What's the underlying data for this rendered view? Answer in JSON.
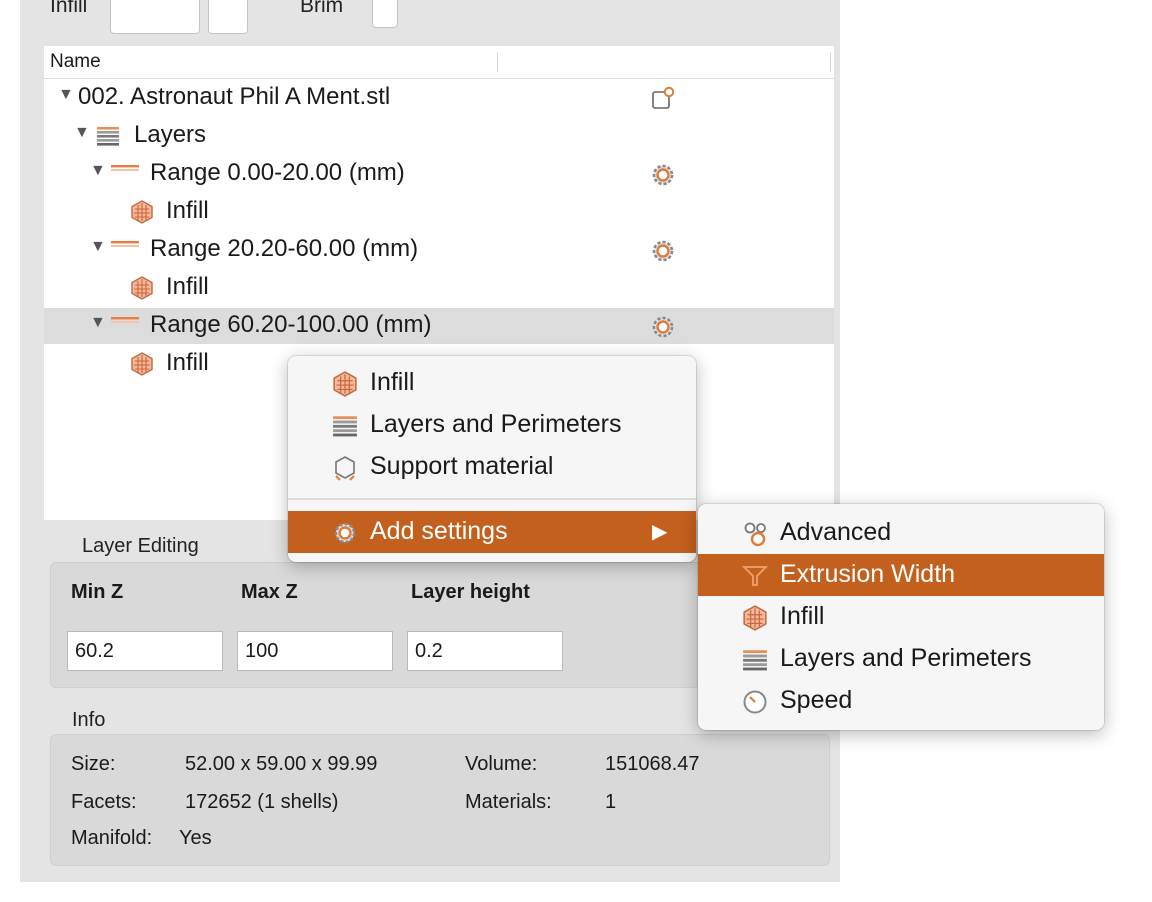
{
  "top_row": {
    "label_left": "Infill",
    "label_right": "Brim"
  },
  "tree": {
    "column_name": "Name",
    "rows": [
      {
        "label": "002. Astronaut Phil A Ment.stl",
        "icon": "object-settings-icon"
      },
      {
        "label": "Layers",
        "icon": "layers-icon"
      },
      {
        "label": "Range 0.00-20.00 (mm)",
        "icon": "range-icon"
      },
      {
        "label": "Infill",
        "icon": "infill-icon"
      },
      {
        "label": "Range 20.20-60.00 (mm)",
        "icon": "range-icon"
      },
      {
        "label": "Infill",
        "icon": "infill-icon"
      },
      {
        "label": "Range 60.20-100.00 (mm)",
        "icon": "range-icon",
        "selected": true
      },
      {
        "label": "Infill",
        "icon": "infill-icon"
      }
    ]
  },
  "layer_editing": {
    "title": "Layer Editing",
    "min_z_label": "Min Z",
    "max_z_label": "Max Z",
    "layer_height_label": "Layer height",
    "min_z": "60.2",
    "max_z": "100",
    "layer_height": "0.2"
  },
  "info": {
    "title": "Info",
    "size_label": "Size:",
    "size": "52.00 x 59.00 x 99.99",
    "volume_label": "Volume:",
    "volume": "151068.47",
    "facets_label": "Facets:",
    "facets": "172652 (1 shells)",
    "materials_label": "Materials:",
    "materials": "1",
    "manifold_label": "Manifold:",
    "manifold": "Yes"
  },
  "context_menu": {
    "items": [
      "Infill",
      "Layers and Perimeters",
      "Support material"
    ],
    "add_settings": "Add settings",
    "arrow": "▶"
  },
  "submenu": {
    "items": [
      "Advanced",
      "Extrusion Width",
      "Infill",
      "Layers and Perimeters",
      "Speed"
    ],
    "highlighted": "Extrusion Width"
  },
  "colors": {
    "accent": "#c4601e",
    "panel": "#e4e4e4",
    "selection": "#dcdcdc"
  }
}
